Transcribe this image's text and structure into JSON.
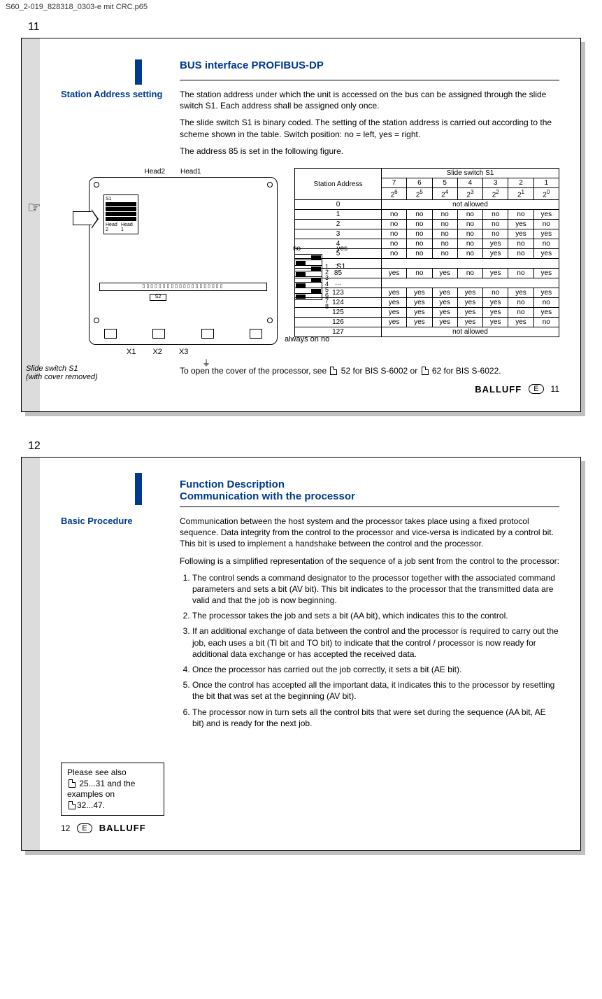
{
  "doc_header": "S60_2-019_828318_0303-e mit CRC.p65",
  "brand": "BALLUFF",
  "lang": "E",
  "page11": {
    "num": "11",
    "title": "BUS interface PROFIBUS-DP",
    "left_label": "Station Address setting",
    "p1": "The station address under which the unit is accessed on the bus can be assigned through the slide switch S1. Each address shall be assigned only once.",
    "p2": "The slide switch S1 is binary coded. The setting of the station address is carried out according to the scheme shown in the table. Switch position: no = left, yes = right.",
    "p3": "The address 85 is set in the following figure.",
    "fig": {
      "head2": "Head2",
      "head1": "Head1",
      "s1_box_label": "S1",
      "head2_in": "Head 2",
      "head1_in": "Head 1",
      "noyes_no": "no",
      "noyes_yes": "yes",
      "s1_label": "S1",
      "nums": "1\n2\n3\n4\n5\n6\n7\n8",
      "always": "always on no",
      "caption1": "Slide switch S1",
      "caption2": "(with cover removed)",
      "x1": "X1",
      "x2": "X2",
      "x3": "X3",
      "s2": "S2"
    },
    "table": {
      "title": "Slide switch S1",
      "sa": "Station Address",
      "cols_top": [
        "7",
        "6",
        "5",
        "4",
        "3",
        "2",
        "1"
      ],
      "cols_pow": [
        "2",
        "2",
        "2",
        "2",
        "2",
        "2",
        "2"
      ],
      "cols_exp": [
        "6",
        "5",
        "4",
        "3",
        "2",
        "1",
        "0"
      ],
      "rows": [
        {
          "addr": "0",
          "span": "not allowed"
        },
        {
          "addr": "1",
          "v": [
            "no",
            "no",
            "no",
            "no",
            "no",
            "no",
            "yes"
          ]
        },
        {
          "addr": "2",
          "v": [
            "no",
            "no",
            "no",
            "no",
            "no",
            "yes",
            "no"
          ]
        },
        {
          "addr": "3",
          "v": [
            "no",
            "no",
            "no",
            "no",
            "no",
            "yes",
            "yes"
          ]
        },
        {
          "addr": "4",
          "v": [
            "no",
            "no",
            "no",
            "no",
            "yes",
            "no",
            "no"
          ]
        },
        {
          "addr": "5",
          "v": [
            "no",
            "no",
            "no",
            "no",
            "yes",
            "no",
            "yes"
          ]
        },
        {
          "addr": "...",
          "blank": true
        },
        {
          "addr": "85",
          "v": [
            "yes",
            "no",
            "yes",
            "no",
            "yes",
            "no",
            "yes"
          ]
        },
        {
          "addr": "...",
          "blank": true
        },
        {
          "addr": "123",
          "v": [
            "yes",
            "yes",
            "yes",
            "yes",
            "no",
            "yes",
            "yes"
          ]
        },
        {
          "addr": "124",
          "v": [
            "yes",
            "yes",
            "yes",
            "yes",
            "yes",
            "no",
            "no"
          ]
        },
        {
          "addr": "125",
          "v": [
            "yes",
            "yes",
            "yes",
            "yes",
            "yes",
            "no",
            "yes"
          ]
        },
        {
          "addr": "126",
          "v": [
            "yes",
            "yes",
            "yes",
            "yes",
            "yes",
            "yes",
            "no"
          ]
        },
        {
          "addr": "127",
          "span": "not allowed"
        }
      ]
    },
    "cover_note_pre": "To open the cover of the processor, see ",
    "cover_note_mid": " 52 for BIS S-6002 or ",
    "cover_note_post": " 62 for BIS S-6022.",
    "footer_page": "11"
  },
  "page12": {
    "num": "12",
    "title1": "Function Description",
    "title2": "Communication with the processor",
    "left_label": "Basic Procedure",
    "p1": "Communication between the host system and the processor takes place using a fixed protocol sequence. Data integrity from the control to the processor and vice-versa is indicated by a control bit. This bit is used to implement a handshake between the control and the processor.",
    "p2": "Following is a simplified representation of the sequence of a job sent from the control to the processor:",
    "steps": [
      "The control sends a command designator to the processor together with the associated command parameters and sets a bit (AV bit). This bit indicates to the processor that the transmitted data are valid and that the job is now beginning.",
      "The processor takes the job and sets a bit (AA bit), which indicates this to the control.",
      "If an additional exchange of data between the control and the processor is required to carry out the job, each uses a bit (TI bit and TO bit) to indicate that the control / processor is now ready for additional data exchange or has accepted the received data.",
      "Once the processor has carried out the job correctly, it sets a bit (AE bit).",
      "Once the control has accepted all the important data, it indicates this to the processor by resetting the bit that was set at the beginning (AV bit).",
      "The processor now in turn sets all the control bits that were set during the sequence (AA bit, AE bit) and is ready for the next job."
    ],
    "note_l1": "Please see also",
    "note_l2": " 25...31 and the",
    "note_l3": "examples on",
    "note_l4": "32...47.",
    "footer_page": "12"
  }
}
